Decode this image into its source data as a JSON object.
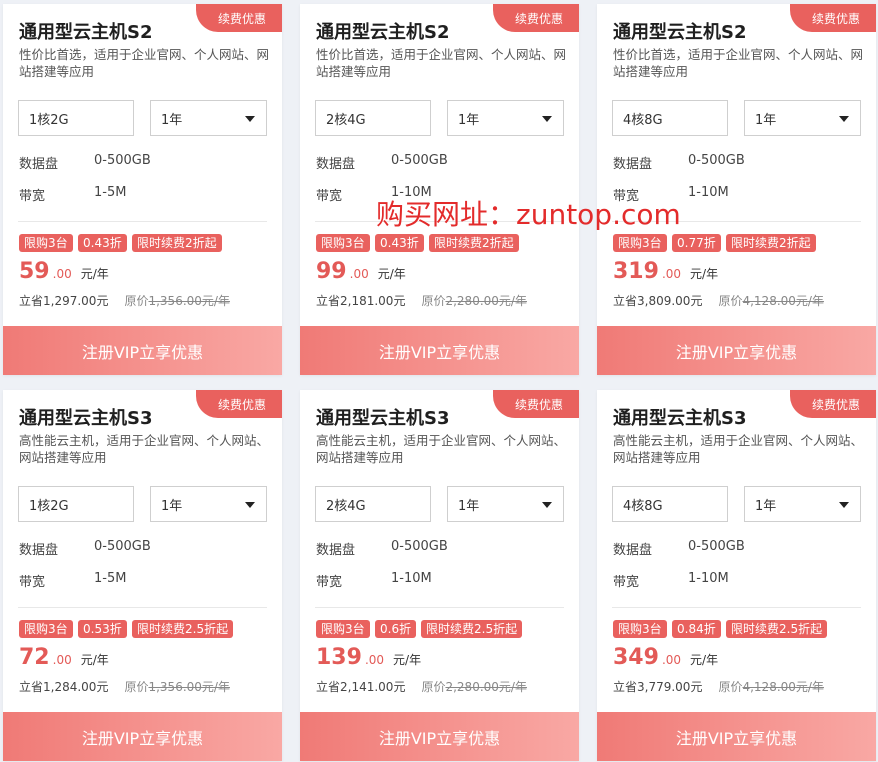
{
  "watermark": "购买网址：zuntop.com",
  "spec_labels": {
    "disk": "数据盘",
    "bandwidth": "带宽"
  },
  "cards": [
    {
      "badge": "续费优惠",
      "title": "通用型云主机S2",
      "desc": "性价比首选，适用于企业官网、个人网站、网站搭建等应用",
      "config": "1核2G",
      "period": "1年",
      "disk": "0-500GB",
      "bandwidth": "1-5M",
      "tags": [
        "限购3台",
        "0.43折",
        "限时续费2折起"
      ],
      "price_int": "59",
      "price_dec": ".00",
      "price_unit": "元/年",
      "saving": "立省1,297.00元",
      "orig_label": "原价",
      "orig_value": "1,356.00元/年",
      "cta": "注册VIP立享优惠"
    },
    {
      "badge": "续费优惠",
      "title": "通用型云主机S2",
      "desc": "性价比首选，适用于企业官网、个人网站、网站搭建等应用",
      "config": "2核4G",
      "period": "1年",
      "disk": "0-500GB",
      "bandwidth": "1-10M",
      "tags": [
        "限购3台",
        "0.43折",
        "限时续费2折起"
      ],
      "price_int": "99",
      "price_dec": ".00",
      "price_unit": "元/年",
      "saving": "立省2,181.00元",
      "orig_label": "原价",
      "orig_value": "2,280.00元/年",
      "cta": "注册VIP立享优惠"
    },
    {
      "badge": "续费优惠",
      "title": "通用型云主机S2",
      "desc": "性价比首选，适用于企业官网、个人网站、网站搭建等应用",
      "config": "4核8G",
      "period": "1年",
      "disk": "0-500GB",
      "bandwidth": "1-10M",
      "tags": [
        "限购3台",
        "0.77折",
        "限时续费2折起"
      ],
      "price_int": "319",
      "price_dec": ".00",
      "price_unit": "元/年",
      "saving": "立省3,809.00元",
      "orig_label": "原价",
      "orig_value": "4,128.00元/年",
      "cta": "注册VIP立享优惠"
    },
    {
      "badge": "续费优惠",
      "title": "通用型云主机S3",
      "desc": "高性能云主机，适用于企业官网、个人网站、网站搭建等应用",
      "config": "1核2G",
      "period": "1年",
      "disk": "0-500GB",
      "bandwidth": "1-5M",
      "tags": [
        "限购3台",
        "0.53折",
        "限时续费2.5折起"
      ],
      "price_int": "72",
      "price_dec": ".00",
      "price_unit": "元/年",
      "saving": "立省1,284.00元",
      "orig_label": "原价",
      "orig_value": "1,356.00元/年",
      "cta": "注册VIP立享优惠"
    },
    {
      "badge": "续费优惠",
      "title": "通用型云主机S3",
      "desc": "高性能云主机，适用于企业官网、个人网站、网站搭建等应用",
      "config": "2核4G",
      "period": "1年",
      "disk": "0-500GB",
      "bandwidth": "1-10M",
      "tags": [
        "限购3台",
        "0.6折",
        "限时续费2.5折起"
      ],
      "price_int": "139",
      "price_dec": ".00",
      "price_unit": "元/年",
      "saving": "立省2,141.00元",
      "orig_label": "原价",
      "orig_value": "2,280.00元/年",
      "cta": "注册VIP立享优惠"
    },
    {
      "badge": "续费优惠",
      "title": "通用型云主机S3",
      "desc": "高性能云主机，适用于企业官网、个人网站、网站搭建等应用",
      "config": "4核8G",
      "period": "1年",
      "disk": "0-500GB",
      "bandwidth": "1-10M",
      "tags": [
        "限购3台",
        "0.84折",
        "限时续费2.5折起"
      ],
      "price_int": "349",
      "price_dec": ".00",
      "price_unit": "元/年",
      "saving": "立省3,779.00元",
      "orig_label": "原价",
      "orig_value": "4,128.00元/年",
      "cta": "注册VIP立享优惠"
    }
  ]
}
